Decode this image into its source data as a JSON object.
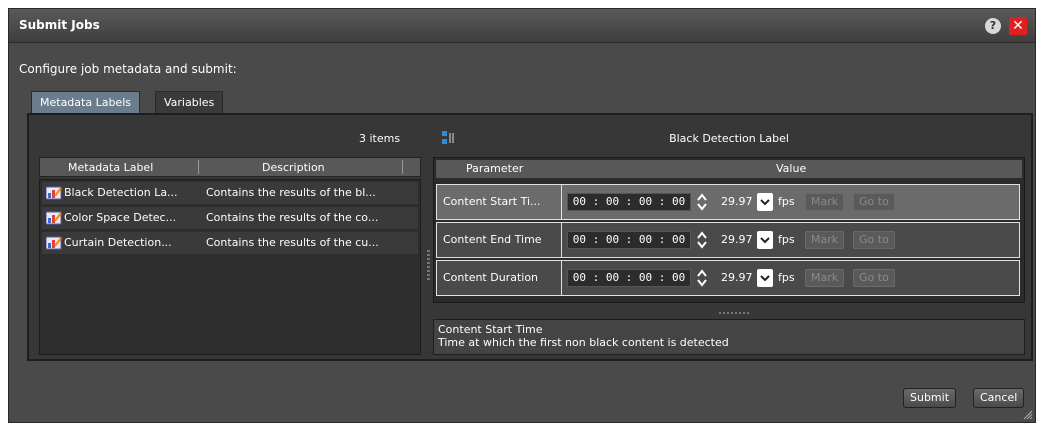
{
  "dialog": {
    "title": "Submit Jobs",
    "help_icon": "question-circle-icon",
    "help_label": "?",
    "close_icon": "close-x-icon",
    "close_label": "✕",
    "subtitle": "Configure job metadata and submit:"
  },
  "tabs": [
    {
      "label": "Metadata Labels",
      "active": true
    },
    {
      "label": "Variables",
      "active": false
    }
  ],
  "left_pane": {
    "count": "3 items",
    "columns": [
      "Metadata Label",
      "Description"
    ],
    "rows": [
      {
        "label": "Black Detection La...",
        "description": "Contains the results of the bl...",
        "icon": "label-chart-icon"
      },
      {
        "label": "Color Space Detec...",
        "description": "Contains the results of the co...",
        "icon": "label-chart-icon"
      },
      {
        "label": "Curtain Detection...",
        "description": "Contains the results of the cu...",
        "icon": "label-chart-icon"
      }
    ]
  },
  "right_pane": {
    "title": "Black Detection Label",
    "columns": [
      "Parameter",
      "Value"
    ],
    "rows": [
      {
        "parameter": "Content Start Ti...",
        "timecode": "00 : 00 : 00 : 00",
        "fps_value": "29.97",
        "fps_label": "fps",
        "mark": "Mark",
        "goto": "Go to",
        "selected": true
      },
      {
        "parameter": "Content End Time",
        "timecode": "00 : 00 : 00 : 00",
        "fps_value": "29.97",
        "fps_label": "fps",
        "mark": "Mark",
        "goto": "Go to",
        "selected": false
      },
      {
        "parameter": "Content Duration",
        "timecode": "00 : 00 : 00 : 00",
        "fps_value": "29.97",
        "fps_label": "fps",
        "mark": "Mark",
        "goto": "Go to",
        "selected": false
      }
    ],
    "description_title": "Content Start Time",
    "description_text": "Time at which the first non black content is detected"
  },
  "footer": {
    "submit": "Submit",
    "cancel": "Cancel"
  },
  "colors": {
    "dialog_bg": "#4a4a4a",
    "active_tab": "#6b7d8c",
    "close_red": "#e02020"
  }
}
